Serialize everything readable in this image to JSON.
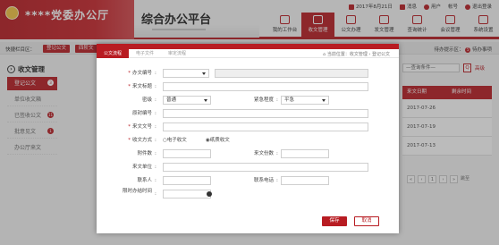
{
  "header": {
    "party_name": "****党委办公厅",
    "platform_title": "综合办公平台",
    "top_links": [
      "2017年8月21日",
      "消息",
      "用户",
      "帐号",
      "退出登录"
    ],
    "nav": [
      {
        "label": "我的工作台",
        "icon": "grid-icon"
      },
      {
        "label": "收文管理",
        "icon": "inbox-icon",
        "active": true
      },
      {
        "label": "公文办理",
        "icon": "document-icon"
      },
      {
        "label": "发文管理",
        "icon": "folder-icon"
      },
      {
        "label": "查询统计",
        "icon": "chart-icon"
      },
      {
        "label": "会议管理",
        "icon": "meeting-icon"
      },
      {
        "label": "系统设置",
        "icon": "gear-icon"
      }
    ]
  },
  "quickbar": {
    "label": "快捷栏目区：",
    "buttons": [
      "登记公文",
      "四阶文"
    ],
    "right_text": "待办提示区：",
    "right_badge": "5",
    "right_tail": "待办事项"
  },
  "sidebar": {
    "title": "收文管理",
    "items": [
      {
        "label": "登记公文",
        "count": "3",
        "active": true
      },
      {
        "label": "单位收文箱",
        "count": "",
        "active": false
      },
      {
        "label": "已签收公文",
        "count": "11",
        "active": false
      },
      {
        "label": "批意见文",
        "count": "1",
        "active": false
      },
      {
        "label": "办公厅来文",
        "count": "",
        "active": false
      }
    ]
  },
  "filters": {
    "select_value": "—查询条件—",
    "search_symbol": "Q",
    "advanced": "高级"
  },
  "table": {
    "columns": [
      "来文日期",
      "剩余时间"
    ],
    "rows": [
      [
        "2017-07-26",
        ""
      ],
      [
        "2017-07-19",
        ""
      ],
      [
        "2017-07-13",
        ""
      ]
    ]
  },
  "pager": {
    "buttons": [
      "«",
      "‹",
      "1",
      "›",
      "»"
    ],
    "info": "跳至"
  },
  "modal": {
    "tabs": [
      {
        "label": "公文流程",
        "active": true
      },
      {
        "label": "电子文件",
        "active": false
      },
      {
        "label": "审定流程",
        "active": false
      }
    ],
    "breadcrumb": "当前位置：收文管理 › 登记公文",
    "form": {
      "doc_number": {
        "label": "办文编号",
        "value": ""
      },
      "doc_title": {
        "label": "来文标题",
        "value": ""
      },
      "secrecy": {
        "label": "密级",
        "value": "普通"
      },
      "urgency": {
        "label": "紧急程度",
        "value": "平急"
      },
      "doc_id": {
        "label": "原封编号",
        "value": ""
      },
      "source_number": {
        "label": "来文文号",
        "value": ""
      },
      "receive_mode": {
        "label": "收文方式",
        "options": [
          "○电子收文",
          "◉纸质收文"
        ],
        "selected": "纸质收文"
      },
      "attachments": {
        "label": "附件数",
        "value": ""
      },
      "copies": {
        "label": "来文份数",
        "value": ""
      },
      "source_unit": {
        "label": "来文单位",
        "value": ""
      },
      "contact": {
        "label": "联系人",
        "value": ""
      },
      "phone": {
        "label": "联系电话",
        "value": ""
      },
      "deadline": {
        "label": "限时办结时间",
        "value": ""
      }
    },
    "buttons": {
      "save": "保存",
      "cancel": "取消"
    }
  },
  "colors": {
    "accent": "#b81c22",
    "header_bg": "#f7f7f7",
    "overlay": "rgba(60,60,60,0.35)"
  }
}
